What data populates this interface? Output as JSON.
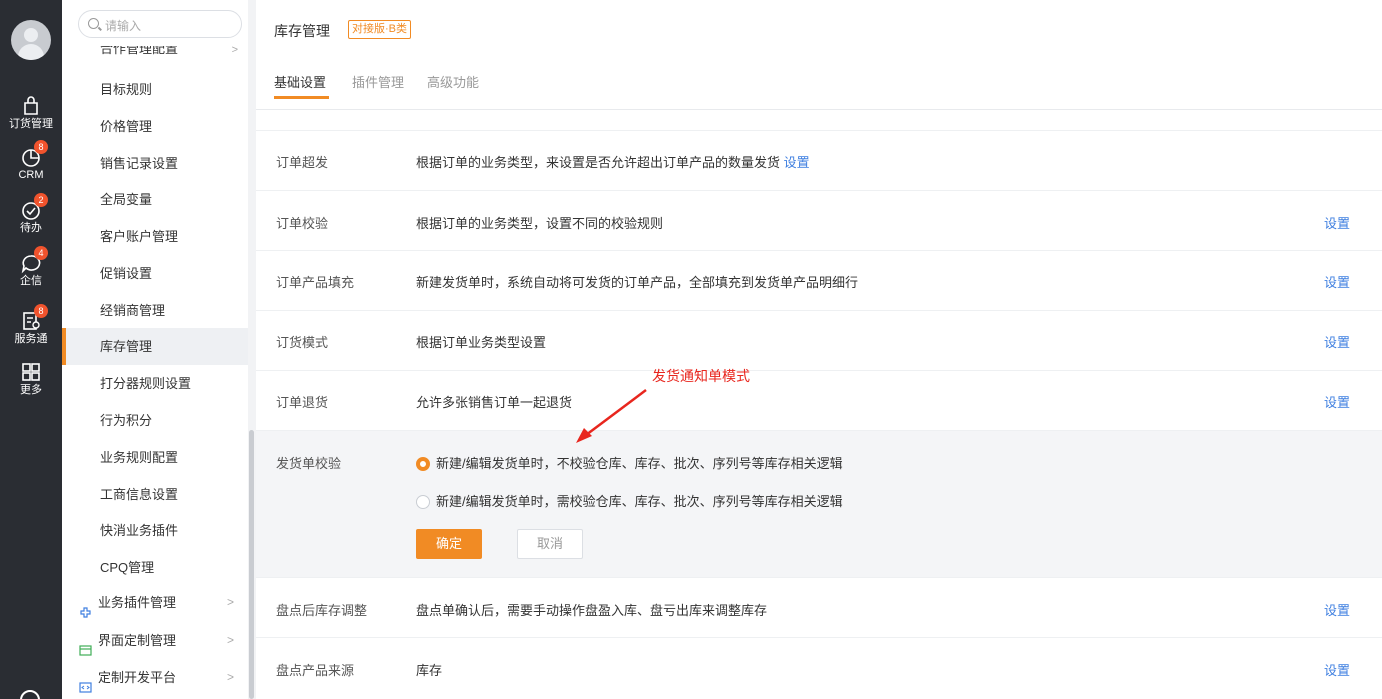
{
  "rail": {
    "items": [
      {
        "label": "订货管理",
        "icon": "bag-icon",
        "badge": ""
      },
      {
        "label": "CRM",
        "icon": "chart-pie-icon",
        "badge": "8"
      },
      {
        "label": "待办",
        "icon": "check-circle-icon",
        "badge": "2"
      },
      {
        "label": "企信",
        "icon": "chat-bubble-icon",
        "badge": "4"
      },
      {
        "label": "服务通",
        "icon": "service-doc-icon",
        "badge": "8"
      },
      {
        "label": "更多",
        "icon": "grid-icon",
        "badge": ""
      }
    ]
  },
  "sidebar": {
    "search_placeholder": "请输入",
    "cut_item": "合作管理配置",
    "items": [
      {
        "label": "目标规则"
      },
      {
        "label": "价格管理"
      },
      {
        "label": "销售记录设置"
      },
      {
        "label": "全局变量"
      },
      {
        "label": "客户账户管理"
      },
      {
        "label": "促销设置"
      },
      {
        "label": "经销商管理"
      },
      {
        "label": "库存管理"
      },
      {
        "label": "打分器规则设置"
      },
      {
        "label": "行为积分"
      },
      {
        "label": "业务规则配置"
      },
      {
        "label": "工商信息设置"
      },
      {
        "label": "快消业务插件"
      },
      {
        "label": "CPQ管理"
      }
    ],
    "active_label": "库存管理",
    "groups": [
      {
        "label": "业务插件管理",
        "icon": "plugin-icon"
      },
      {
        "label": "界面定制管理",
        "icon": "layout-icon"
      },
      {
        "label": "定制开发平台",
        "icon": "code-icon"
      }
    ]
  },
  "header": {
    "title": "库存管理",
    "tag": "对接版·B类",
    "tabs": [
      {
        "label": "基础设置"
      },
      {
        "label": "插件管理"
      },
      {
        "label": "高级功能"
      }
    ]
  },
  "rows": [
    {
      "name": "订单超发",
      "desc": "根据订单的业务类型，来设置是否允许超出订单产品的数量发货",
      "inline_link": "设置",
      "action": ""
    },
    {
      "name": "订单校验",
      "desc": "根据订单的业务类型，设置不同的校验规则",
      "inline_link": "",
      "action": "设置"
    },
    {
      "name": "订单产品填充",
      "desc": "新建发货单时，系统自动将可发货的订单产品，全部填充到发货单产品明细行",
      "inline_link": "",
      "action": "设置"
    },
    {
      "name": "订货模式",
      "desc": "根据订单业务类型设置",
      "inline_link": "",
      "action": "设置"
    },
    {
      "name": "订单退货",
      "desc": "允许多张销售订单一起退货",
      "inline_link": "",
      "action": "设置"
    }
  ],
  "expanded": {
    "name": "发货单校验",
    "options": [
      {
        "label": "新建/编辑发货单时，不校验仓库、库存、批次、序列号等库存相关逻辑",
        "checked": true
      },
      {
        "label": "新建/编辑发货单时，需校验仓库、库存、批次、序列号等库存相关逻辑",
        "checked": false
      }
    ],
    "ok_label": "确定",
    "cancel_label": "取消"
  },
  "rows_after": [
    {
      "name": "盘点后库存调整",
      "desc": "盘点单确认后，需要手动操作盘盈入库、盘亏出库来调整库存",
      "action": "设置"
    },
    {
      "name": "盘点产品来源",
      "desc": "库存",
      "action": "设置"
    }
  ],
  "annotation": {
    "text": "发货通知单模式",
    "color": "#e8261e"
  },
  "colors": {
    "accent": "#f18b24",
    "link": "#3f7fe0",
    "rail_bg": "#2a2d33",
    "badge": "#f0532d"
  }
}
